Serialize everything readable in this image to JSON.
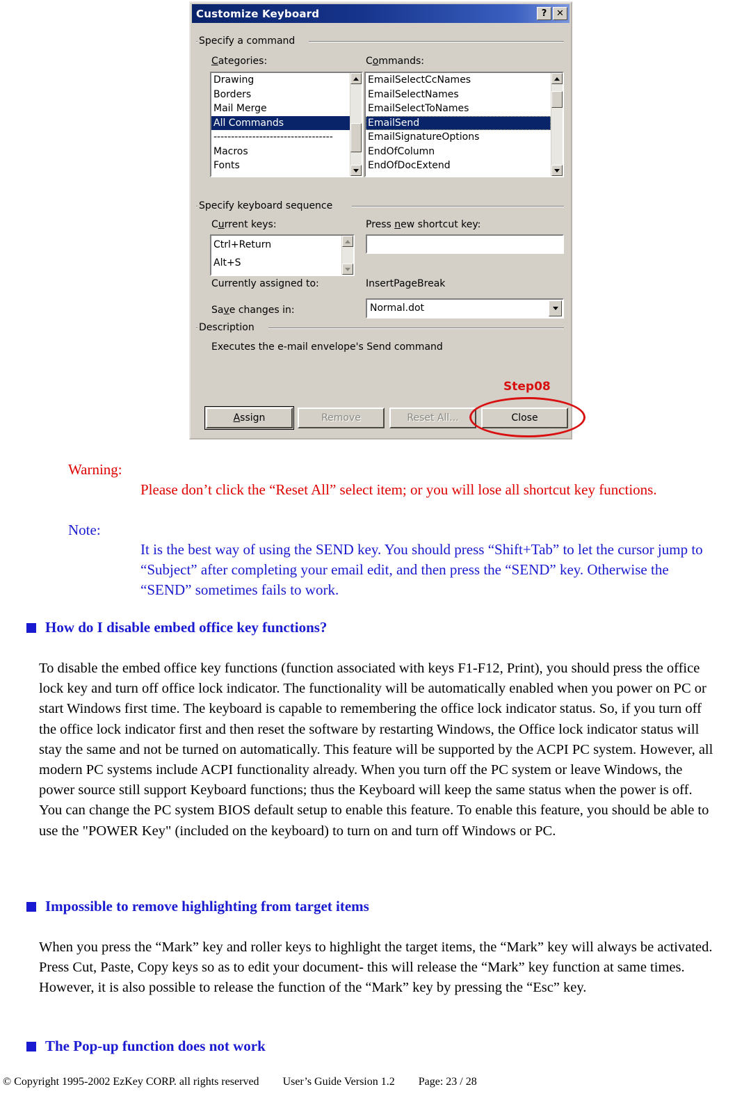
{
  "dialog": {
    "title": "Customize Keyboard",
    "help_button": "?",
    "close_button": "✕",
    "groups": {
      "specify_command": "Specify a command",
      "specify_sequence": "Specify keyboard sequence",
      "description": "Description"
    },
    "categories": {
      "label": "Categories:",
      "items": [
        "Drawing",
        "Borders",
        "Mail Merge",
        "All Commands",
        "----------------------------------",
        "Macros",
        "Fonts"
      ],
      "selected": "All Commands"
    },
    "commands": {
      "label": "Commands:",
      "items": [
        "EmailSelectCcNames",
        "EmailSelectNames",
        "EmailSelectToNames",
        "EmailSend",
        "EmailSignatureOptions",
        "EndOfColumn",
        "EndOfDocExtend"
      ],
      "selected": "EmailSend"
    },
    "current_keys": {
      "label": "Current keys:",
      "items": [
        "Ctrl+Return",
        "Alt+S"
      ]
    },
    "new_shortcut": {
      "label": "Press new shortcut key:",
      "value": ""
    },
    "currently_assigned": {
      "label": "Currently assigned to:",
      "value": "InsertPageBreak"
    },
    "save_changes": {
      "label": "Save changes in:",
      "value": "Normal.dot"
    },
    "description_text": "Executes the e-mail envelope's Send command",
    "buttons": {
      "assign": "Assign",
      "remove": "Remove",
      "reset_all": "Reset All...",
      "close": "Close"
    },
    "annotation": {
      "step_label": "Step08",
      "accent_color": "#d81010"
    }
  },
  "notices": {
    "warning_label": "Warning:",
    "warning_text": "Please don’t click the “Reset All” select item; or you will lose all shortcut key functions.",
    "note_label": "Note:",
    "note_text": "It is the best way of using the SEND key. You should press “Shift+Tab” to let the cursor jump to “Subject” after completing your email edit, and then press the “SEND” key. Otherwise the “SEND” sometimes fails to work.",
    "warning_color": "#e00000",
    "note_color": "#1a1ad0"
  },
  "sections": [
    {
      "heading": "How do I disable embed office key functions?",
      "body": "To disable the embed office key functions (function associated with keys F1-F12, Print), you should press the office lock key and turn off office lock indicator. The functionality will be automatically enabled when you power on PC or start Windows first time. The keyboard is capable to remembering the office lock indicator status. So, if you turn off the office lock indicator first and then reset the software by restarting Windows, the Office lock indicator status will stay the same and not be turned on automatically. This feature will be supported by the ACPI PC system. However, all modern PC systems include ACPI functionality already. When you turn off the PC system or leave Windows, the power source still support Keyboard functions; thus the Keyboard will keep the same status when the power is off. You can change the PC system BIOS default setup to enable this feature. To enable this feature, you should be able to use the \"POWER Key\" (included on the keyboard) to turn on and turn off Windows or PC."
    },
    {
      "heading": "Impossible to remove highlighting from target items",
      "body": "When you press the “Mark” key and roller keys to highlight the target items, the “Mark” key will always be activated. Press Cut, Paste, Copy keys so as to edit your document- this will release the “Mark” key function at same times. However, it is also possible to release the function of the “Mark” key by pressing the “Esc” key."
    },
    {
      "heading": "The Pop-up function does not work",
      "body": ""
    }
  ],
  "footer": {
    "copyright": "© Copyright 1995-2002 EzKey CORP. all rights reserved",
    "guide": "User’s  Guide  Version  1.2",
    "page": "Page:  23 / 28"
  }
}
